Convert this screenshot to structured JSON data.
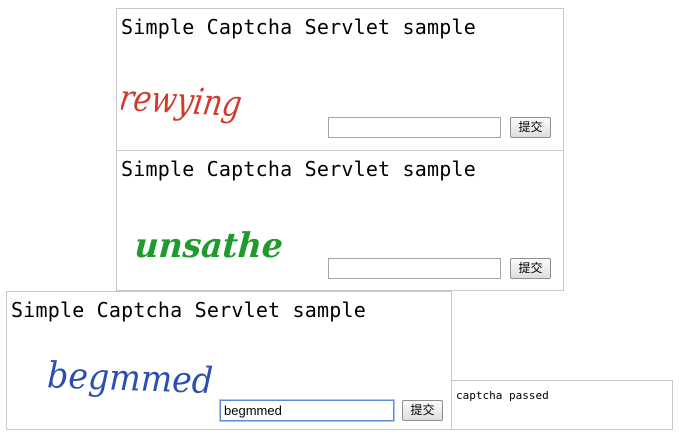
{
  "panels": [
    {
      "title": "Simple Captcha Servlet sample",
      "captcha_text": "rewying",
      "captcha_color": "#d23a2a",
      "answer_value": "",
      "submit_label": "提交"
    },
    {
      "title": "Simple Captcha Servlet sample",
      "captcha_text": "unsathe",
      "captcha_color": "#1f9a2e",
      "answer_value": "",
      "submit_label": "提交"
    },
    {
      "title": "Simple Captcha Servlet sample",
      "captcha_text": "begmmed",
      "captcha_color": "#2a4fb0",
      "answer_value": "begmmed",
      "submit_label": "提交"
    }
  ],
  "result": {
    "message": "captcha passed"
  }
}
